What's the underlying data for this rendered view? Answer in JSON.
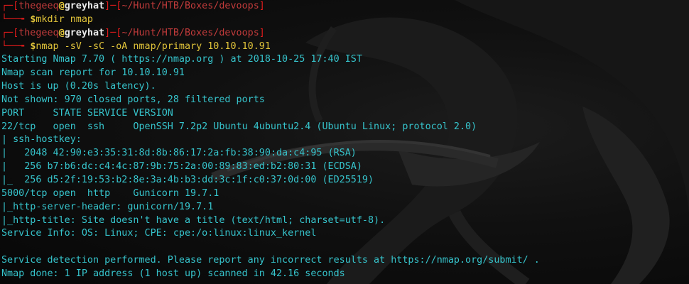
{
  "prompts": [
    {
      "box_top": "┌─",
      "box_bottom": "└──╼ ",
      "lbracket": "[",
      "user": "thegeeq",
      "at": "@",
      "host": "greyhat",
      "rbracket": "]",
      "dash": "─",
      "path_open": "[",
      "path": "~/Hunt/HTB/Boxes/devoops",
      "path_close": "]",
      "dollar": "$",
      "command": "mkdir nmap"
    },
    {
      "box_top": "┌─",
      "box_bottom": "└──╼ ",
      "lbracket": "[",
      "user": "thegeeq",
      "at": "@",
      "host": "greyhat",
      "rbracket": "]",
      "dash": "─",
      "path_open": "[",
      "path": "~/Hunt/HTB/Boxes/devoops",
      "path_close": "]",
      "dollar": "$",
      "command": "nmap -sV -sC -oA nmap/primary 10.10.10.91"
    }
  ],
  "output": [
    "Starting Nmap 7.70 ( https://nmap.org ) at 2018-10-25 17:40 IST",
    "Nmap scan report for 10.10.10.91",
    "Host is up (0.20s latency).",
    "Not shown: 970 closed ports, 28 filtered ports",
    "PORT     STATE SERVICE VERSION",
    "22/tcp   open  ssh     OpenSSH 7.2p2 Ubuntu 4ubuntu2.4 (Ubuntu Linux; protocol 2.0)",
    "| ssh-hostkey:",
    "|   2048 42:90:e3:35:31:8d:8b:86:17:2a:fb:38:90:da:c4:95 (RSA)",
    "|   256 b7:b6:dc:c4:4c:87:9b:75:2a:00:89:83:ed:b2:80:31 (ECDSA)",
    "|_  256 d5:2f:19:53:b2:8e:3a:4b:b3:dd:3c:1f:c0:37:0d:00 (ED25519)",
    "5000/tcp open  http    Gunicorn 19.7.1",
    "|_http-server-header: gunicorn/19.7.1",
    "|_http-title: Site doesn't have a title (text/html; charset=utf-8).",
    "Service Info: OS: Linux; CPE: cpe:/o:linux:linux_kernel",
    "",
    "Service detection performed. Please report any incorrect results at https://nmap.org/submit/ .",
    "Nmap done: 1 IP address (1 host up) scanned in 42.16 seconds"
  ]
}
